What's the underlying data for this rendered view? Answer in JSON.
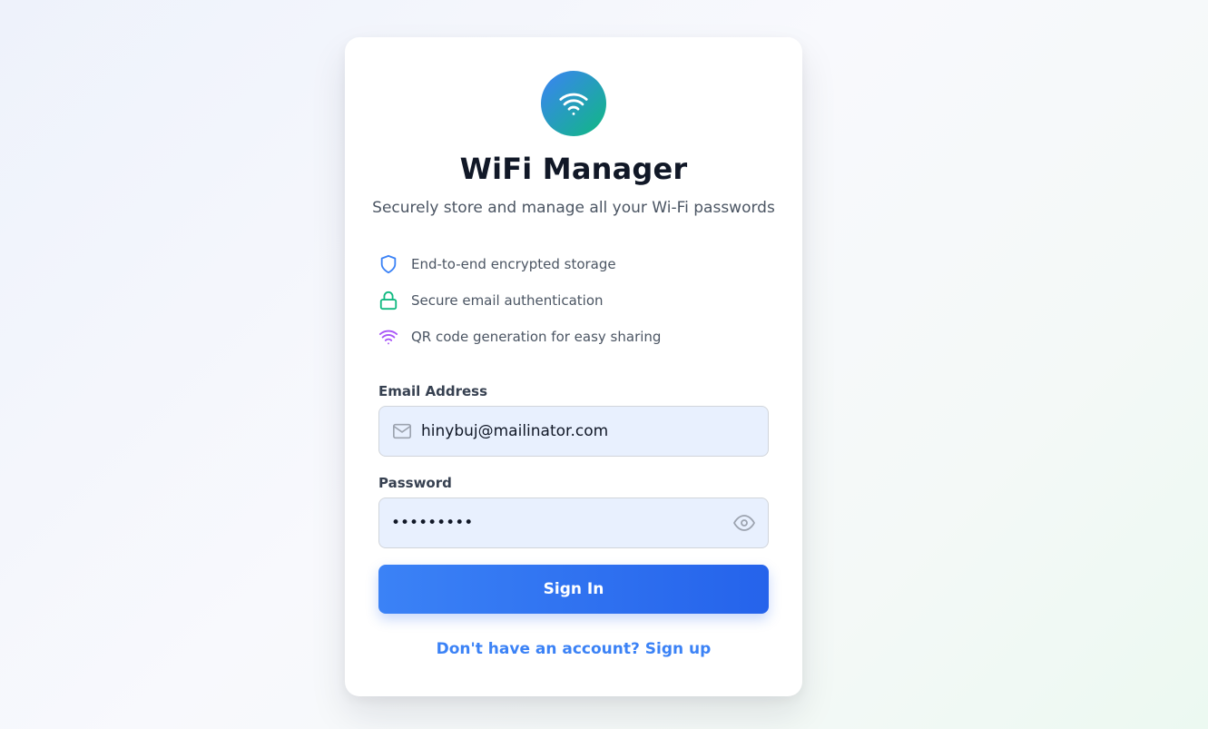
{
  "app": {
    "title": "WiFi Manager",
    "subtitle": "Securely store and manage all your Wi-Fi passwords"
  },
  "features": [
    {
      "icon": "shield-icon",
      "label": "End-to-end encrypted storage",
      "color": "#3b82f6"
    },
    {
      "icon": "lock-icon",
      "label": "Secure email authentication",
      "color": "#10b981"
    },
    {
      "icon": "wifi-icon",
      "label": "QR code generation for easy sharing",
      "color": "#a855f7"
    }
  ],
  "form": {
    "email_label": "Email Address",
    "email_value": "hinybuj@mailinator.com",
    "password_label": "Password",
    "password_value": "•••••••••",
    "submit_label": "Sign In",
    "signup_link": "Don't have an account? Sign up"
  },
  "colors": {
    "primary": "#3b82f6",
    "accent_green": "#10b981",
    "accent_purple": "#a855f7"
  }
}
